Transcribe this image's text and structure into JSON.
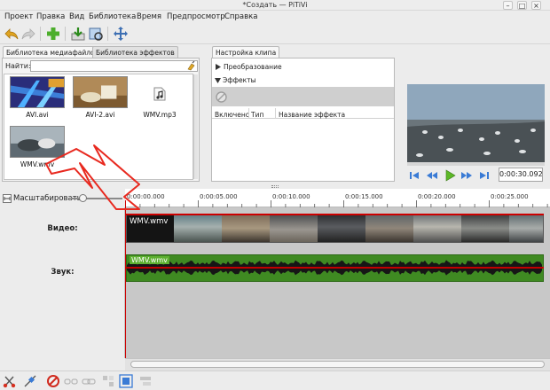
{
  "window": {
    "title": "*Создать — PiTiVi",
    "btn_min": "–",
    "btn_max": "□",
    "btn_close": "×"
  },
  "menu": [
    "Проект",
    "Правка",
    "Вид",
    "Библиотека",
    "Время",
    "Предпросмотр",
    "Справка"
  ],
  "toolbar": {
    "icons": [
      "undo-icon",
      "redo-icon",
      "add-media-icon",
      "render-icon",
      "import-icon",
      "fullscreen-icon"
    ]
  },
  "library": {
    "tab_media": "Библиотека медиафайлов",
    "tab_effects": "Библиотека эффектов",
    "search_label": "Найти:",
    "search_value": "",
    "items": [
      {
        "name": "AVI.avi"
      },
      {
        "name": "AVI-2.avi"
      },
      {
        "name": "WMV.mp3"
      },
      {
        "name": "WMV.wmv"
      }
    ]
  },
  "clip": {
    "tab_title": "Настройка клипа",
    "transform": "Преобразование",
    "effects": "Эффекты",
    "col_enabled": "Включено",
    "col_type": "Тип",
    "col_name": "Название эффекта"
  },
  "viewer": {
    "timecode": "0:00:30.092"
  },
  "timeline": {
    "zoom_label": "Масштабировать",
    "zoom_level": 0.22,
    "ruler_ticks": [
      "0:00:00.000",
      "0:00:05.000",
      "0:00:10.000",
      "0:00:15.000",
      "0:00:20.000",
      "0:00:25.000"
    ],
    "video_label": "Видео:",
    "audio_label": "Звук:",
    "video_clip": "WMV.wmv",
    "audio_clip": "WMV.wmv"
  },
  "colors": {
    "audio_track": "#3f8a22",
    "playhead": "#cc0000",
    "annotation_arrow": "#e8291f"
  }
}
